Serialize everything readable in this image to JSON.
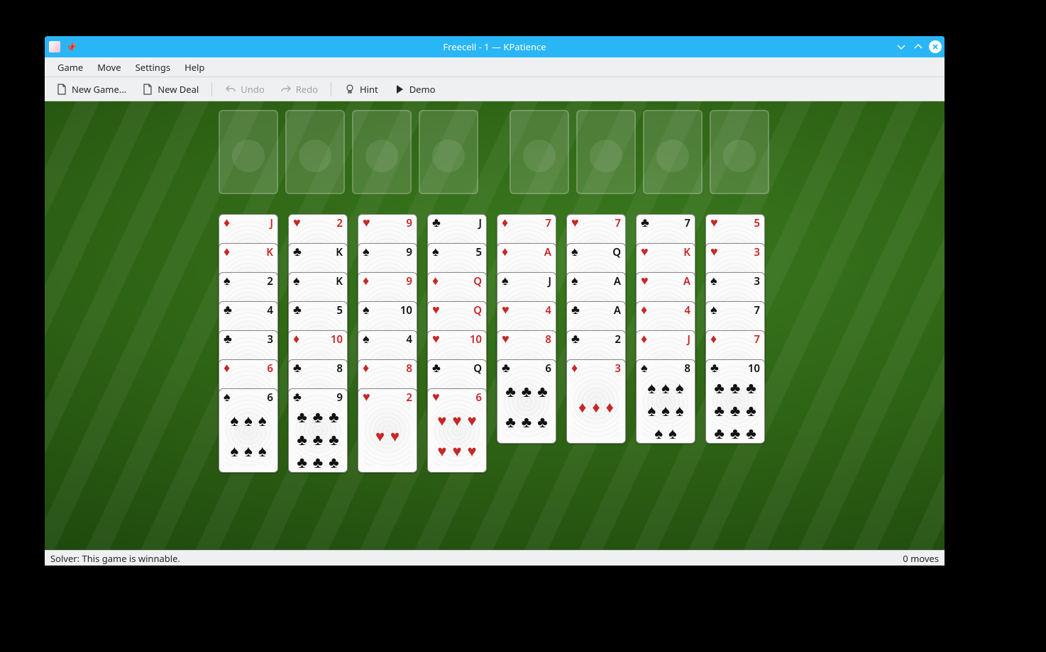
{
  "window": {
    "title": "Freecell - 1 — KPatience"
  },
  "menu": {
    "game": "Game",
    "move": "Move",
    "settings": "Settings",
    "help": "Help"
  },
  "toolbar": {
    "new_game": "New Game...",
    "new_deal": "New Deal",
    "undo": "Undo",
    "redo": "Redo",
    "hint": "Hint",
    "demo": "Demo"
  },
  "status": {
    "solver": "Solver: This game is winnable.",
    "moves": "0 moves"
  },
  "suits": {
    "spade": "♠",
    "heart": "♥",
    "diamond": "♦",
    "club": "♣"
  },
  "colors": {
    "red": "#c62828",
    "black": "#111111",
    "felt": "#1f4a0e",
    "titlebar": "#29b6f6"
  },
  "freecells": 4,
  "foundations": 4,
  "cascades": [
    [
      {
        "rank": "J",
        "suit": "diamond"
      },
      {
        "rank": "K",
        "suit": "diamond"
      },
      {
        "rank": "2",
        "suit": "spade"
      },
      {
        "rank": "4",
        "suit": "club"
      },
      {
        "rank": "3",
        "suit": "club"
      },
      {
        "rank": "6",
        "suit": "diamond"
      },
      {
        "rank": "6",
        "suit": "spade"
      }
    ],
    [
      {
        "rank": "2",
        "suit": "heart"
      },
      {
        "rank": "K",
        "suit": "club"
      },
      {
        "rank": "K",
        "suit": "spade"
      },
      {
        "rank": "5",
        "suit": "club"
      },
      {
        "rank": "10",
        "suit": "diamond"
      },
      {
        "rank": "8",
        "suit": "club"
      },
      {
        "rank": "9",
        "suit": "club"
      }
    ],
    [
      {
        "rank": "9",
        "suit": "heart"
      },
      {
        "rank": "9",
        "suit": "spade"
      },
      {
        "rank": "9",
        "suit": "diamond"
      },
      {
        "rank": "10",
        "suit": "spade"
      },
      {
        "rank": "4",
        "suit": "spade"
      },
      {
        "rank": "8",
        "suit": "diamond"
      },
      {
        "rank": "2",
        "suit": "heart"
      }
    ],
    [
      {
        "rank": "J",
        "suit": "club"
      },
      {
        "rank": "5",
        "suit": "spade"
      },
      {
        "rank": "Q",
        "suit": "diamond"
      },
      {
        "rank": "Q",
        "suit": "heart"
      },
      {
        "rank": "10",
        "suit": "heart"
      },
      {
        "rank": "Q",
        "suit": "club"
      },
      {
        "rank": "6",
        "suit": "heart"
      }
    ],
    [
      {
        "rank": "7",
        "suit": "diamond"
      },
      {
        "rank": "A",
        "suit": "diamond"
      },
      {
        "rank": "J",
        "suit": "spade"
      },
      {
        "rank": "4",
        "suit": "heart"
      },
      {
        "rank": "8",
        "suit": "heart"
      },
      {
        "rank": "6",
        "suit": "club"
      }
    ],
    [
      {
        "rank": "7",
        "suit": "heart"
      },
      {
        "rank": "Q",
        "suit": "spade"
      },
      {
        "rank": "A",
        "suit": "spade"
      },
      {
        "rank": "A",
        "suit": "club"
      },
      {
        "rank": "2",
        "suit": "club"
      },
      {
        "rank": "3",
        "suit": "diamond"
      }
    ],
    [
      {
        "rank": "7",
        "suit": "club"
      },
      {
        "rank": "K",
        "suit": "heart"
      },
      {
        "rank": "A",
        "suit": "heart"
      },
      {
        "rank": "4",
        "suit": "diamond"
      },
      {
        "rank": "J",
        "suit": "diamond"
      },
      {
        "rank": "8",
        "suit": "spade"
      }
    ],
    [
      {
        "rank": "5",
        "suit": "heart"
      },
      {
        "rank": "3",
        "suit": "heart"
      },
      {
        "rank": "3",
        "suit": "spade"
      },
      {
        "rank": "7",
        "suit": "spade"
      },
      {
        "rank": "7",
        "suit": "diamond"
      },
      {
        "rank": "10",
        "suit": "club"
      }
    ]
  ]
}
